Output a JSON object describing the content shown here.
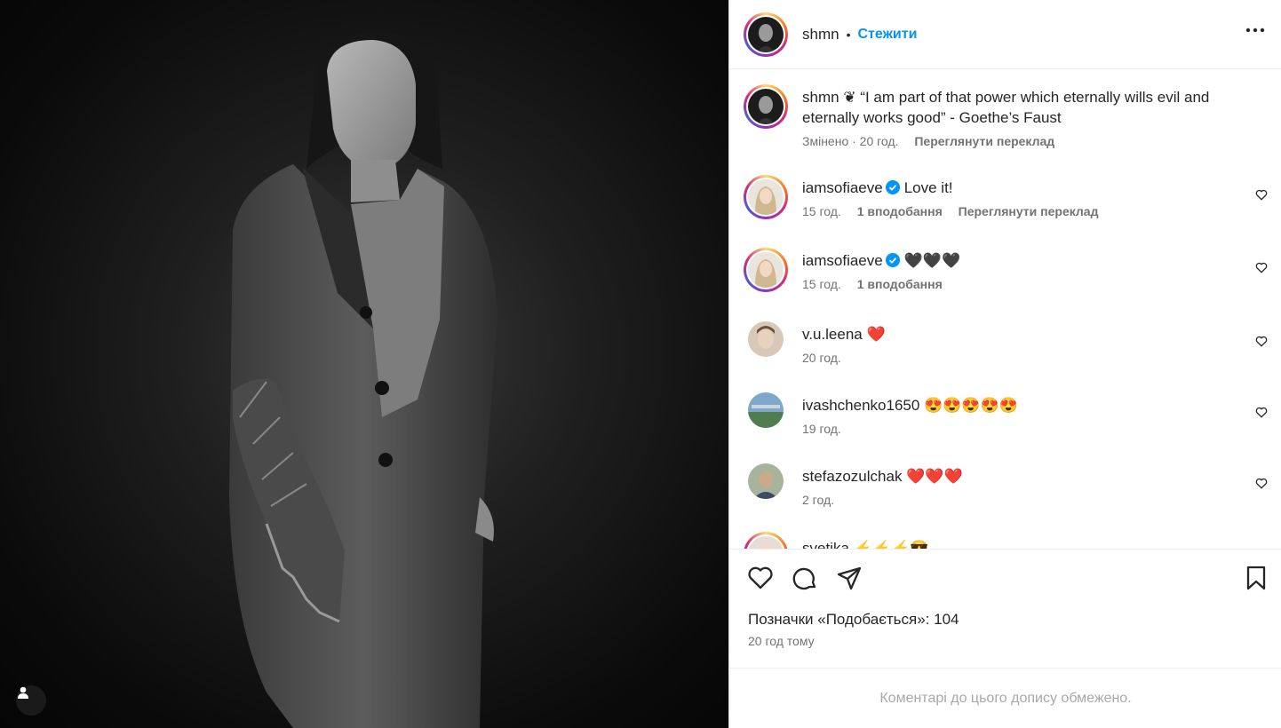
{
  "post": {
    "author": "shmn",
    "separator": "•",
    "follow_label": "Стежити",
    "caption_emoji": "❦",
    "caption_text": "“I am part of that power which eternally wills evil and eternally works good” - Goethe’s Faust",
    "caption_meta": "Змінено · 20 год.",
    "see_translation": "Переглянути переклад"
  },
  "comments": [
    {
      "user": "iamsofiaeve",
      "verified": true,
      "text": "Love it!",
      "time": "15 год.",
      "likes": "1 вподобання",
      "translate": "Переглянути переклад"
    },
    {
      "user": "iamsofiaeve",
      "verified": true,
      "text": "🖤🖤🖤",
      "emoji": [
        "black-heart",
        "black-heart",
        "black-heart"
      ],
      "time": "15 год.",
      "likes": "1 вподобання"
    },
    {
      "user": "v.u.leena",
      "verified": false,
      "text": "❤️",
      "emoji": [
        "red-heart"
      ],
      "time": "20 год."
    },
    {
      "user": "ivashchenko1650",
      "verified": false,
      "text": "😍😍😍😍😍",
      "emoji": [
        "heart-eyes",
        "heart-eyes",
        "heart-eyes",
        "heart-eyes",
        "heart-eyes"
      ],
      "time": "19 год."
    },
    {
      "user": "stefazozulchak",
      "verified": false,
      "text": "❤️❤️❤️",
      "emoji": [
        "red-heart",
        "red-heart",
        "red-heart"
      ],
      "time": "2 год."
    },
    {
      "user": "svetika",
      "verified": false,
      "text": "⚡⚡⚡😎",
      "emoji": [
        "bolt",
        "bolt",
        "bolt",
        "sunglasses"
      ]
    }
  ],
  "actions": {
    "likes_label": "Позначки «Подобається»: 104",
    "time_ago": "20 год тому"
  },
  "comments_limited": "Коментарі до цього допису обмежено.",
  "colors": {
    "link": "#0095f6",
    "muted": "#737373",
    "red_heart": "#e0245e"
  }
}
